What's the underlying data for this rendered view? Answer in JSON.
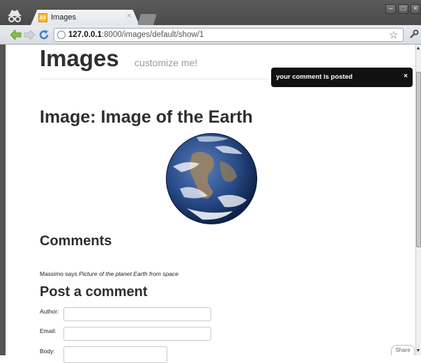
{
  "browser": {
    "tab_title": "Images",
    "tab_close": "×",
    "favicon": "favicon-icon",
    "url_host": "127.0.0.1",
    "url_rest": ":8000/images/default/show/1",
    "window_controls": {
      "minimize": "–",
      "maximize": "□",
      "close": "×"
    }
  },
  "site": {
    "title": "Images",
    "tagline": "customize me!"
  },
  "flash": {
    "message": "your comment is posted",
    "close": "×"
  },
  "image": {
    "heading": "Image: Image of the Earth"
  },
  "comments": {
    "heading": "Comments",
    "items": [
      {
        "author": "Massimo",
        "says": "says",
        "body": "Picture of the planet Earth from space"
      }
    ]
  },
  "form": {
    "heading": "Post a comment",
    "author_label": "Author:",
    "email_label": "Email:",
    "body_label": "Body:"
  },
  "share_label": "Share",
  "colors": {
    "heading_text": "#2f2f2f",
    "tagline": "#9a9a9a",
    "flash_bg": "#111111"
  }
}
